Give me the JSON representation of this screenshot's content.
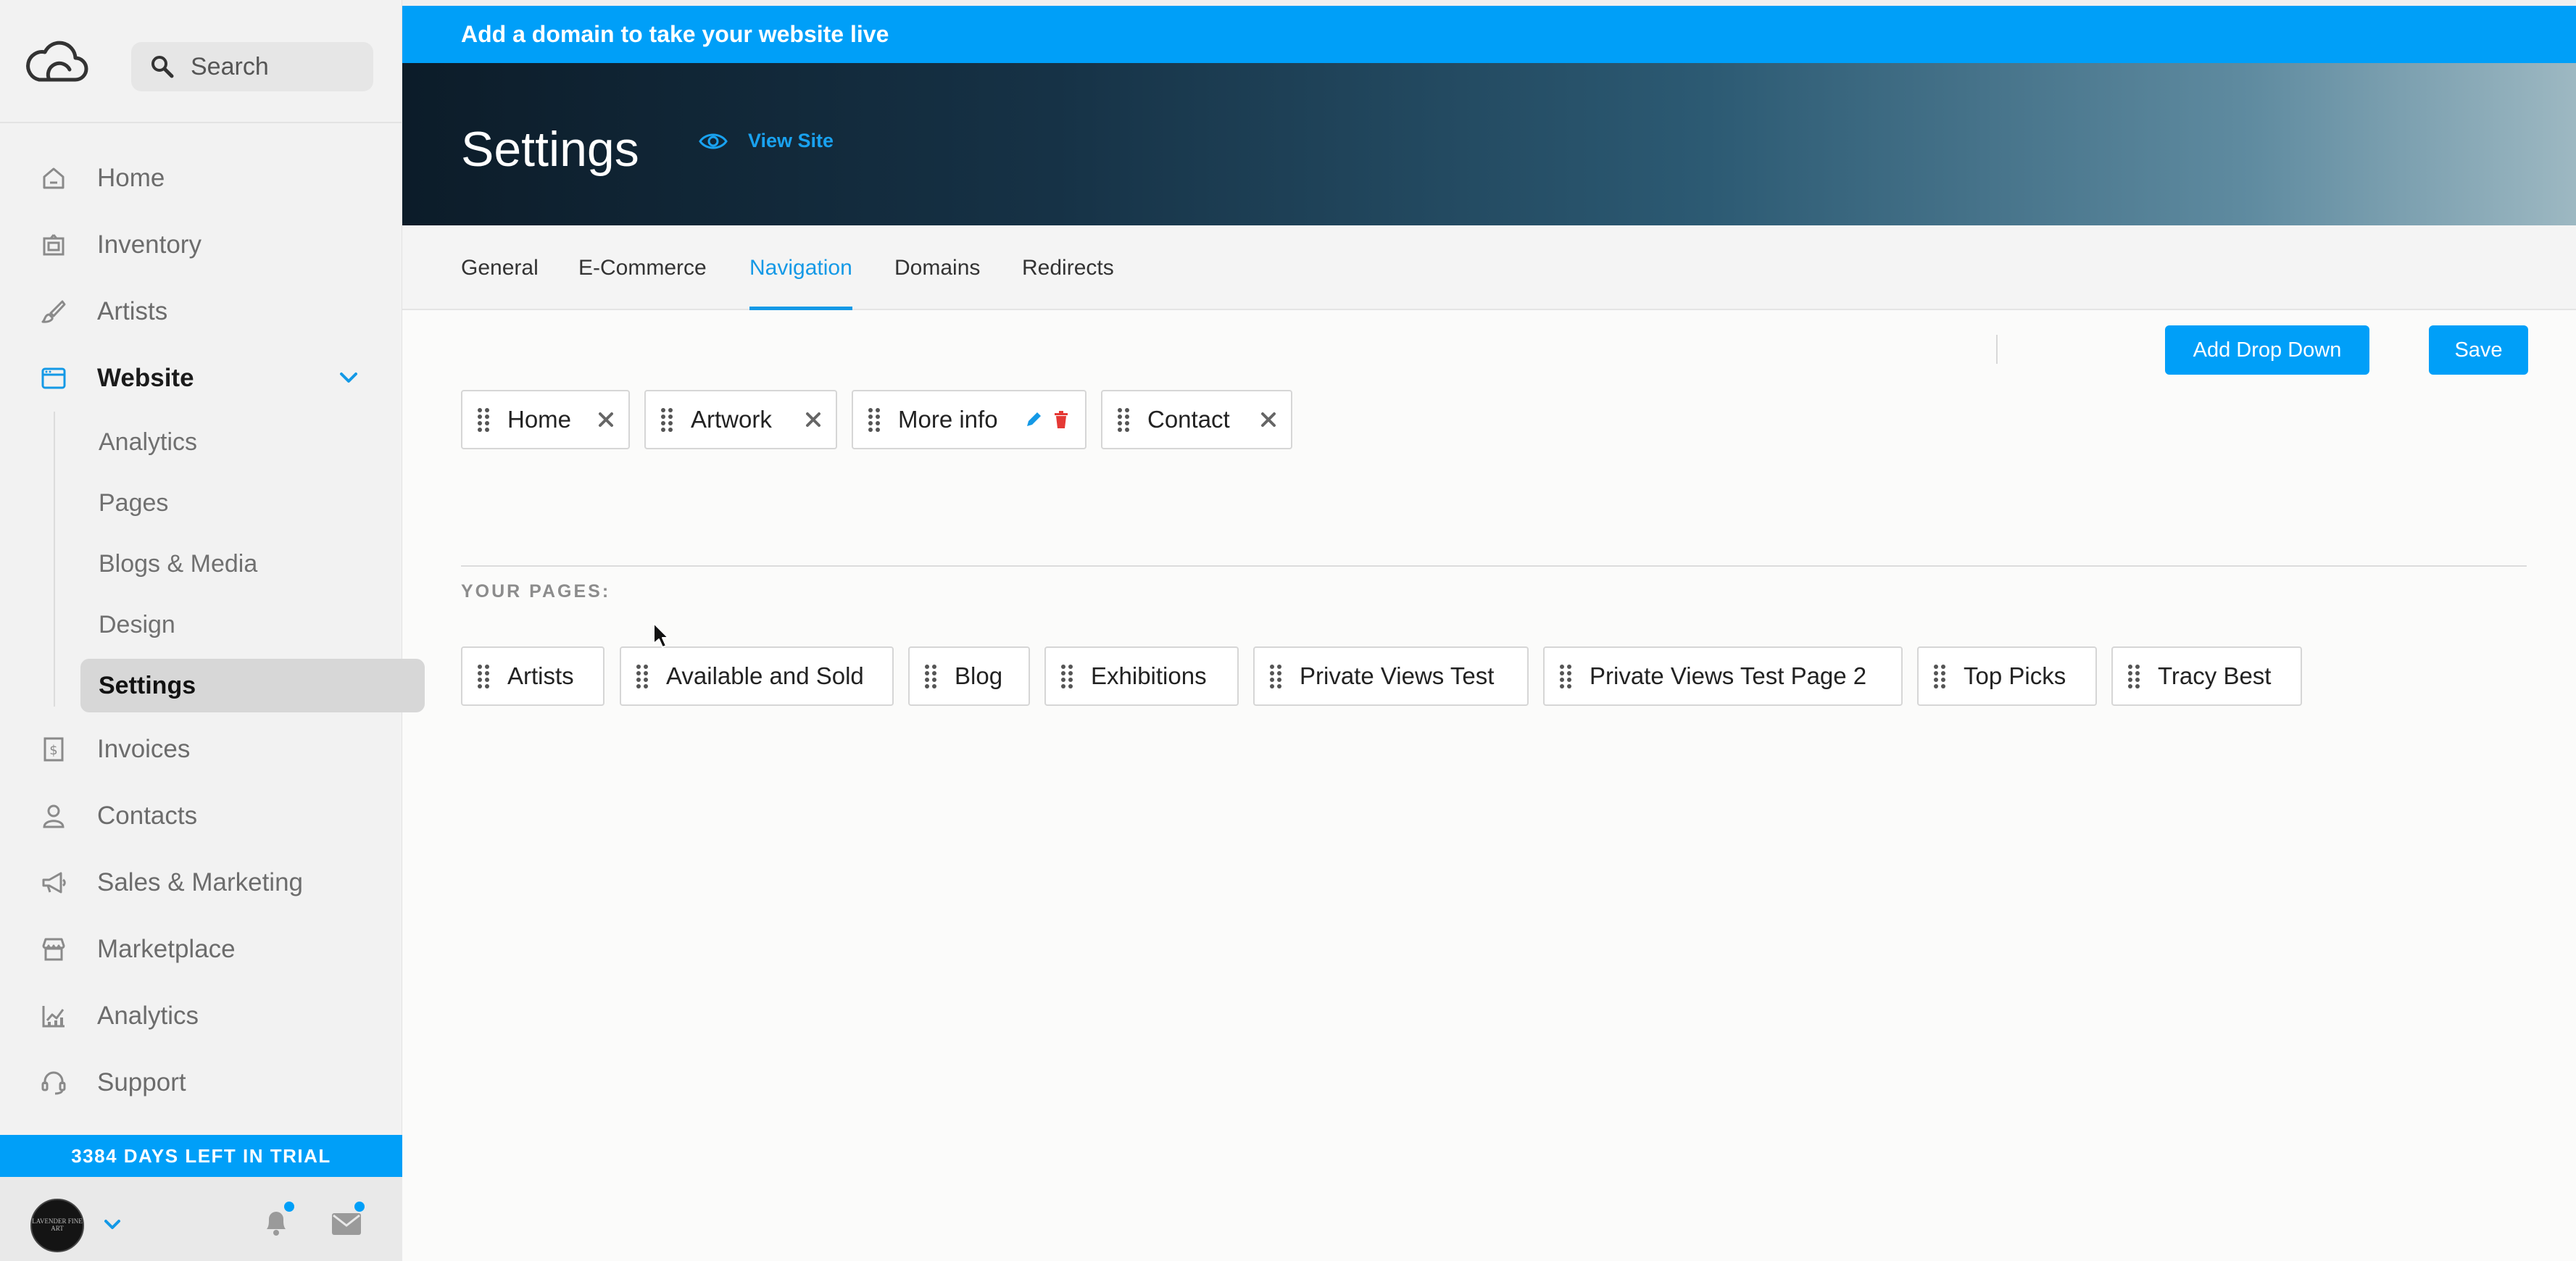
{
  "search": {
    "placeholder": "Search"
  },
  "sidebar": {
    "items": [
      {
        "label": "Home",
        "icon": "home-icon"
      },
      {
        "label": "Inventory",
        "icon": "inventory-icon"
      },
      {
        "label": "Artists",
        "icon": "brush-icon"
      },
      {
        "label": "Website",
        "icon": "browser-icon",
        "expanded": true
      },
      {
        "label": "Invoices",
        "icon": "invoice-icon"
      },
      {
        "label": "Contacts",
        "icon": "person-icon"
      },
      {
        "label": "Sales & Marketing",
        "icon": "megaphone-icon"
      },
      {
        "label": "Marketplace",
        "icon": "store-icon"
      },
      {
        "label": "Analytics",
        "icon": "chart-icon"
      },
      {
        "label": "Support",
        "icon": "headset-icon"
      }
    ],
    "website_sub": [
      "Analytics",
      "Pages",
      "Blogs & Media",
      "Design",
      "Settings"
    ],
    "trial_text": "3384 DAYS LEFT IN TRIAL",
    "avatar_text": "LAVENDER FINE ART"
  },
  "banner": {
    "text": "Add a domain to take your website live"
  },
  "header": {
    "title": "Settings",
    "view_site": "View Site"
  },
  "tabs": [
    "General",
    "E-Commerce",
    "Navigation",
    "Domains",
    "Redirects"
  ],
  "active_tab": "Navigation",
  "actions": {
    "add_dropdown": "Add Drop Down",
    "save": "Save"
  },
  "nav_items": [
    "Home",
    "Artwork",
    "More info",
    "Contact"
  ],
  "pages_label": "YOUR PAGES:",
  "pages": [
    "Artists",
    "Available and Sold",
    "Blog",
    "Exhibitions",
    "Private Views Test",
    "Private Views Test Page 2",
    "Top Picks",
    "Tracy Best"
  ],
  "colors": {
    "accent": "#009ff8",
    "delete": "#e53935",
    "sidebar_bg": "#f2f2f2"
  }
}
